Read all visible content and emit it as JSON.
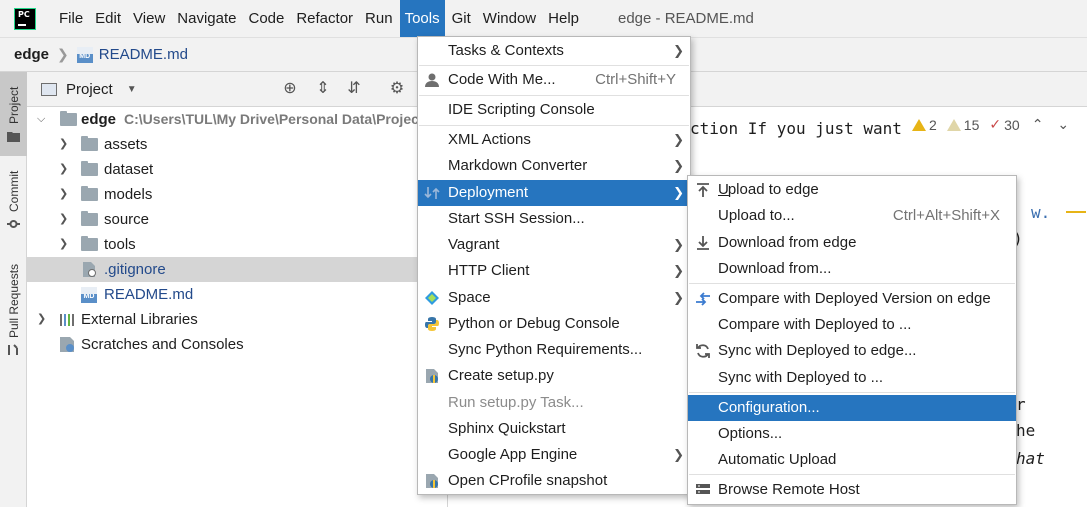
{
  "menubar": {
    "items": [
      "File",
      "Edit",
      "View",
      "Navigate",
      "Code",
      "Refactor",
      "Run",
      "Tools",
      "Git",
      "Window",
      "Help"
    ],
    "active": "Tools",
    "window_title": "edge - README.md"
  },
  "breadcrumb": {
    "root": "edge",
    "file": "README.md"
  },
  "side_tabs": {
    "project": "Project",
    "commit": "Commit",
    "pull_requests": "Pull Requests"
  },
  "project_panel": {
    "title": "Project",
    "root": {
      "name": "edge",
      "path": "C:\\Users\\TUL\\My Drive\\Personal Data\\Projec"
    },
    "children": [
      "assets",
      "dataset",
      "models",
      "source",
      "tools"
    ],
    "files": [
      ".gitignore",
      "README.md"
    ],
    "external": "External Libraries",
    "scratches": "Scratches and Consoles"
  },
  "editor": {
    "code_line_1": "ction If you just want",
    "frag_w": "w.",
    "frag_paren": ")",
    "frag_r": "r",
    "frag_he": "he",
    "frag_hat": "hat",
    "inspection": {
      "warnings": "2",
      "weak_warnings": "15",
      "typos": "30"
    }
  },
  "tools_menu": {
    "items": [
      {
        "label": "Tasks & Contexts",
        "submenu": true
      },
      {
        "label": "Code With Me...",
        "shortcut": "Ctrl+Shift+Y"
      },
      {
        "label": "IDE Scripting Console"
      },
      {
        "label": "XML Actions",
        "submenu": true
      },
      {
        "label": "Markdown Converter",
        "submenu": true
      },
      {
        "label": "Deployment",
        "submenu": true,
        "highlighted": true
      },
      {
        "label": "Start SSH Session..."
      },
      {
        "label": "Vagrant",
        "submenu": true
      },
      {
        "label": "HTTP Client",
        "submenu": true
      },
      {
        "label": "Space",
        "submenu": true
      },
      {
        "label": "Python or Debug Console"
      },
      {
        "label": "Sync Python Requirements..."
      },
      {
        "label": "Create setup.py"
      },
      {
        "label": "Run setup.py Task...",
        "disabled": true
      },
      {
        "label": "Sphinx Quickstart"
      },
      {
        "label": "Google App Engine",
        "submenu": true
      },
      {
        "label": "Open CProfile snapshot"
      }
    ]
  },
  "deployment_menu": {
    "items": [
      {
        "label": "Upload to edge"
      },
      {
        "label": "Upload to...",
        "shortcut": "Ctrl+Alt+Shift+X"
      },
      {
        "label": "Download from edge"
      },
      {
        "label": "Download from..."
      },
      {
        "label": "Compare with Deployed Version on edge"
      },
      {
        "label": "Compare with Deployed to ..."
      },
      {
        "label": "Sync with Deployed to edge..."
      },
      {
        "label": "Sync with Deployed to ..."
      },
      {
        "label": "Configuration...",
        "highlighted": true
      },
      {
        "label": "Options..."
      },
      {
        "label": "Automatic Upload"
      },
      {
        "label": "Browse Remote Host"
      }
    ]
  },
  "colors": {
    "accent": "#2675bf",
    "folder": "#9aa7b0",
    "selection": "#d5d5d5"
  }
}
